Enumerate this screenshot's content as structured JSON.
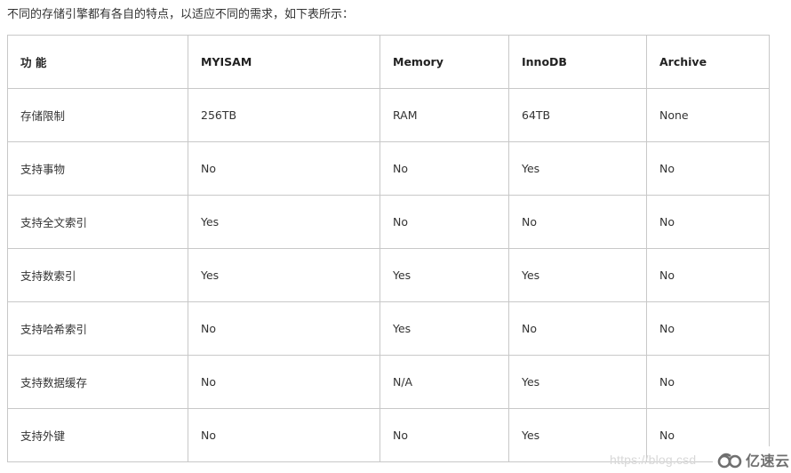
{
  "intro_text": "不同的存储引擎都有各自的特点，以适应不同的需求，如下表所示：",
  "table": {
    "headers": [
      "功 能",
      "MYISAM",
      "Memory",
      "InnoDB",
      "Archive"
    ],
    "rows": [
      [
        "存储限制",
        "256TB",
        "RAM",
        "64TB",
        "None"
      ],
      [
        "支持事物",
        "No",
        "No",
        "Yes",
        "No"
      ],
      [
        "支持全文索引",
        "Yes",
        "No",
        "No",
        "No"
      ],
      [
        "支持数索引",
        "Yes",
        "Yes",
        "Yes",
        "No"
      ],
      [
        "支持哈希索引",
        "No",
        "Yes",
        "No",
        "No"
      ],
      [
        "支持数据缓存",
        "No",
        "N/A",
        "Yes",
        "No"
      ],
      [
        "支持外键",
        "No",
        "No",
        "Yes",
        "No"
      ]
    ]
  },
  "watermark": {
    "url_text": "https://blog.csd",
    "brand_icon": "cloud-logo-icon",
    "brand_text": "亿速云"
  }
}
